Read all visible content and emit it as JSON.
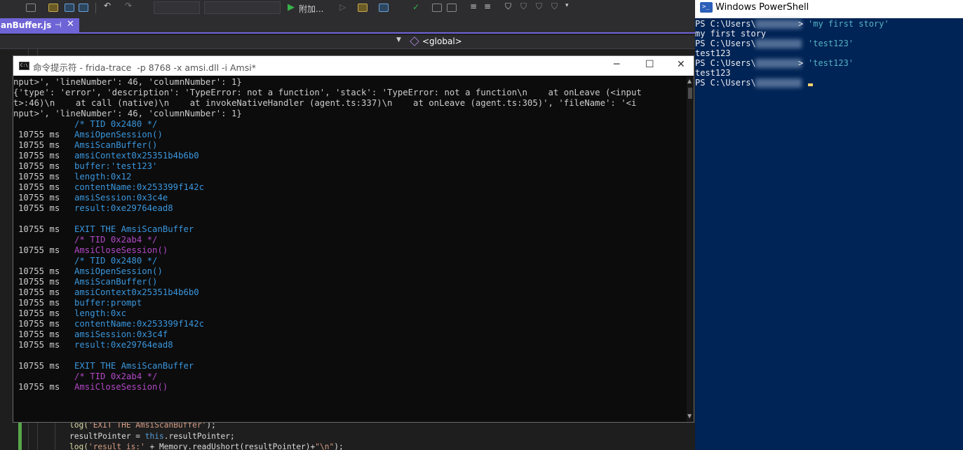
{
  "vs": {
    "toolbar": {
      "run_label": "附加..."
    },
    "tab": {
      "title": "anBuffer.js",
      "pin_glyph": "⊣",
      "close_glyph": "✕"
    },
    "nav": {
      "scope": "<global>"
    },
    "editor_lines": [
      {
        "parts": [
          {
            "t": "log(",
            "c": "fn"
          },
          {
            "t": "'EXIT THE AmsiScanBuffer'",
            "c": "str"
          },
          {
            "t": ");",
            "c": ""
          }
        ]
      },
      {
        "parts": [
          {
            "t": "resultPointer = ",
            "c": ""
          },
          {
            "t": "this",
            "c": "kw"
          },
          {
            "t": ".resultPointer;",
            "c": ""
          }
        ]
      },
      {
        "parts": [
          {
            "t": "log(",
            "c": "fn"
          },
          {
            "t": "'result is:'",
            "c": "str"
          },
          {
            "t": " + Memory.readUshort(resultPointer)+",
            "c": ""
          },
          {
            "t": "\"\\n\"",
            "c": "str"
          },
          {
            "t": ");",
            "c": ""
          }
        ]
      }
    ]
  },
  "cmd": {
    "title": "命令提示符 - frida-trace  -p 8768 -x amsi.dll -i Amsi*",
    "controls": {
      "minimize": "─",
      "maximize": "☐",
      "close": "✕"
    },
    "raw_lines": [
      "nput>', 'lineNumber': 46, 'columnNumber': 1}",
      "{'type': 'error', 'description': 'TypeError: not a function', 'stack': 'TypeError: not a function\\n    at onLeave (<input",
      "t>:46)\\n    at call (native)\\n    at invokeNativeHandler (agent.ts:337)\\n    at onLeave (agent.ts:305)', 'fileName': '<i",
      "nput>', 'lineNumber': 46, 'columnNumber': 1}"
    ],
    "trace_lines": [
      {
        "ts": "",
        "text": "/* TID 0x2480 */",
        "color": "blue"
      },
      {
        "ts": "10755 ms",
        "text": "AmsiOpenSession()",
        "color": "blue"
      },
      {
        "ts": "10755 ms",
        "text": "AmsiScanBuffer()",
        "color": "blue"
      },
      {
        "ts": "10755 ms",
        "text": "amsiContext0x25351b4b6b0",
        "color": "blue"
      },
      {
        "ts": "10755 ms",
        "text": "buffer:'test123'",
        "color": "blue"
      },
      {
        "ts": "10755 ms",
        "text": "length:0x12",
        "color": "blue"
      },
      {
        "ts": "10755 ms",
        "text": "contentName:0x253399f142c",
        "color": "blue"
      },
      {
        "ts": "10755 ms",
        "text": "amsiSession:0x3c4e",
        "color": "blue"
      },
      {
        "ts": "10755 ms",
        "text": "result:0xe29764ead8",
        "color": "blue"
      },
      {
        "ts": "",
        "text": "",
        "color": "blue"
      },
      {
        "ts": "10755 ms",
        "text": "EXIT THE AmsiScanBuffer",
        "color": "blue"
      },
      {
        "ts": "",
        "text": "/* TID 0x2ab4 */",
        "color": "mag"
      },
      {
        "ts": "10755 ms",
        "text": "AmsiCloseSession()",
        "color": "mag"
      },
      {
        "ts": "",
        "text": "/* TID 0x2480 */",
        "color": "blue"
      },
      {
        "ts": "10755 ms",
        "text": "AmsiOpenSession()",
        "color": "blue"
      },
      {
        "ts": "10755 ms",
        "text": "AmsiScanBuffer()",
        "color": "blue"
      },
      {
        "ts": "10755 ms",
        "text": "amsiContext0x25351b4b6b0",
        "color": "blue"
      },
      {
        "ts": "10755 ms",
        "text": "buffer:prompt",
        "color": "blue"
      },
      {
        "ts": "10755 ms",
        "text": "length:0xc",
        "color": "blue"
      },
      {
        "ts": "10755 ms",
        "text": "contentName:0x253399f142c",
        "color": "blue"
      },
      {
        "ts": "10755 ms",
        "text": "amsiSession:0x3c4f",
        "color": "blue"
      },
      {
        "ts": "10755 ms",
        "text": "result:0xe29764ead8",
        "color": "blue"
      },
      {
        "ts": "",
        "text": "",
        "color": "blue"
      },
      {
        "ts": "10755 ms",
        "text": "EXIT THE AmsiScanBuffer",
        "color": "blue"
      },
      {
        "ts": "",
        "text": "/* TID 0x2ab4 */",
        "color": "mag"
      },
      {
        "ts": "10755 ms",
        "text": "AmsiCloseSession()",
        "color": "mag"
      }
    ]
  },
  "ps": {
    "title": "Windows PowerShell",
    "lines": [
      {
        "prompt": "PS C:\\Users\\",
        "blurred": true,
        "suffix": ">",
        "cmd": "'my first story'",
        "out": "my first story"
      },
      {
        "prompt": "PS C:\\Users\\",
        "blurred": true,
        "suffix": "",
        "cmd": "'test123'",
        "out": "test123"
      },
      {
        "prompt": "PS C:\\Users\\",
        "blurred": true,
        "suffix": ">",
        "cmd": "'test123'",
        "out": "test123"
      },
      {
        "prompt": "PS C:\\Users\\",
        "blurred": true,
        "suffix": "",
        "cmd": "",
        "out": ""
      }
    ]
  },
  "colors": {
    "cmd_blue": "#3a96dd",
    "cmd_magenta": "#b148c6",
    "ps_background": "#012456",
    "vs_accent": "#6f64d6"
  }
}
